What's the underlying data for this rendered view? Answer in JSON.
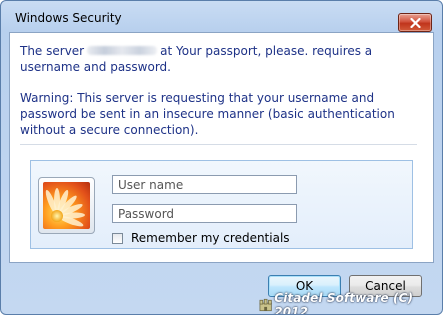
{
  "window": {
    "title": "Windows Security"
  },
  "message": {
    "server_prefix": "The server",
    "server_suffix": "at Your passport, please. requires a username and password.",
    "warning": "Warning: This server is requesting that your username and password be sent in an insecure manner (basic authentication without a secure connection)."
  },
  "credentials": {
    "username_placeholder": "User name",
    "password_placeholder": "Password",
    "remember_label": "Remember my credentials",
    "remember_checked": false
  },
  "buttons": {
    "ok_label": "OK",
    "cancel_label": "Cancel"
  },
  "watermark": {
    "text": "Citadel Software (C) 2012"
  },
  "icons": {
    "close": "close-icon",
    "avatar": "user-avatar-flower",
    "watermark_logo": "citadel-logo-icon"
  },
  "colors": {
    "message_text": "#1e3287",
    "close_button": "#c0341c",
    "panel_border": "#9ec0e4"
  }
}
